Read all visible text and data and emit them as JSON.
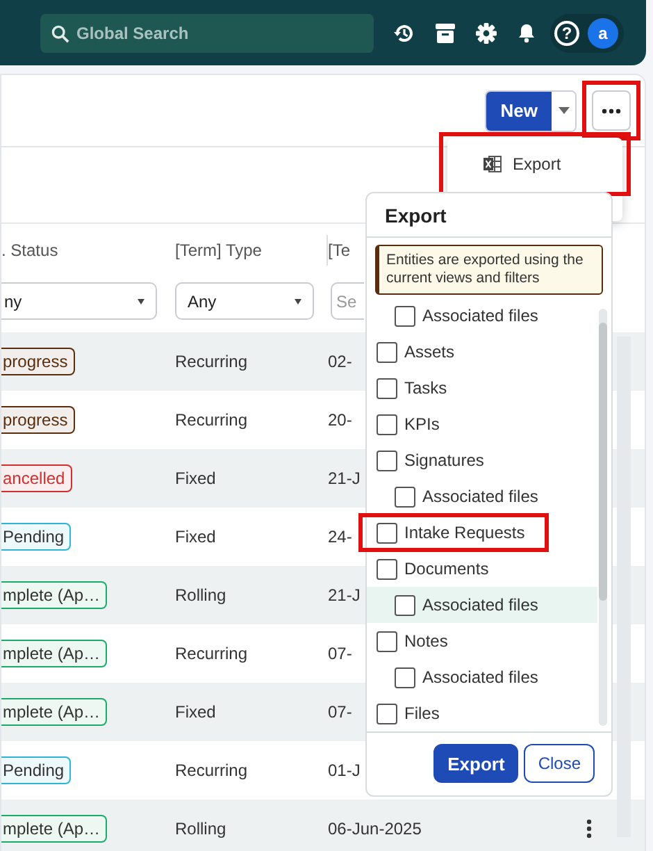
{
  "top_bar": {
    "search": {
      "placeholder": "Global Search"
    },
    "help": "?",
    "avatar": "a"
  },
  "toolbar": {
    "new_button": "New",
    "more_button_annotated": true
  },
  "actions_menu": {
    "items": [
      {
        "label": "Export",
        "annotated": true
      }
    ]
  },
  "table": {
    "columns": [
      ". Status",
      "[Term] Type",
      "[Te"
    ],
    "filters": [
      {
        "value": "ny"
      },
      {
        "value": "Any"
      },
      {
        "placeholder": "Se"
      }
    ],
    "rows": [
      {
        "status": "progress",
        "color": "#5a2d0c",
        "type": "Recurring",
        "date": "02-"
      },
      {
        "status": "progress",
        "color": "#5a2d0c",
        "type": "Recurring",
        "date": "20-"
      },
      {
        "status": "ancelled",
        "color": "#d32f2f",
        "type": "Fixed",
        "date": "21-J"
      },
      {
        "status": "Pending",
        "color": "#2fb3d6",
        "type": "Fixed",
        "date": "24-"
      },
      {
        "status": "mplete (Ap…",
        "color": "#1aab6b",
        "type": "Rolling",
        "date": "21-J"
      },
      {
        "status": "mplete (Ap…",
        "color": "#1aab6b",
        "type": "Recurring",
        "date": "07-"
      },
      {
        "status": "mplete (Ap…",
        "color": "#1aab6b",
        "type": "Fixed",
        "date": "07-"
      },
      {
        "status": "Pending",
        "color": "#2fb3d6",
        "type": "Recurring",
        "date": "01-J"
      },
      {
        "status": "mplete (Ap…",
        "color": "#1aab6b",
        "type": "Rolling",
        "date": "06-Jun-2025",
        "menu": true
      }
    ]
  },
  "export_dialog": {
    "title": "Export",
    "note": "Entities are exported using the current views and filters",
    "leading_children": [
      {
        "label": "Associated files",
        "checked": false,
        "highlighted": false,
        "annotated": false
      }
    ],
    "items": [
      {
        "label": "Assets",
        "checked": false,
        "highlighted": false,
        "annotated": false
      },
      {
        "label": "Tasks",
        "checked": false,
        "highlighted": false,
        "annotated": false
      },
      {
        "label": "KPIs",
        "checked": false,
        "highlighted": false,
        "annotated": false
      },
      {
        "label": "Signatures",
        "checked": false,
        "highlighted": false,
        "annotated": false,
        "children": [
          {
            "label": "Associated files",
            "checked": false,
            "highlighted": false,
            "annotated": false
          }
        ]
      },
      {
        "label": "Intake Requests",
        "checked": false,
        "highlighted": false,
        "annotated": true
      },
      {
        "label": "Documents",
        "checked": false,
        "highlighted": false,
        "annotated": false,
        "children": [
          {
            "label": "Associated files",
            "checked": false,
            "highlighted": true,
            "annotated": false
          }
        ]
      },
      {
        "label": "Notes",
        "checked": false,
        "highlighted": false,
        "annotated": false,
        "children": [
          {
            "label": "Associated files",
            "checked": false,
            "highlighted": false,
            "annotated": false
          }
        ]
      },
      {
        "label": "Files",
        "checked": false,
        "highlighted": false,
        "annotated": false
      }
    ],
    "buttons": [
      {
        "label": "Export",
        "kind": "primary"
      },
      {
        "label": "Close",
        "kind": "secondary"
      }
    ]
  }
}
